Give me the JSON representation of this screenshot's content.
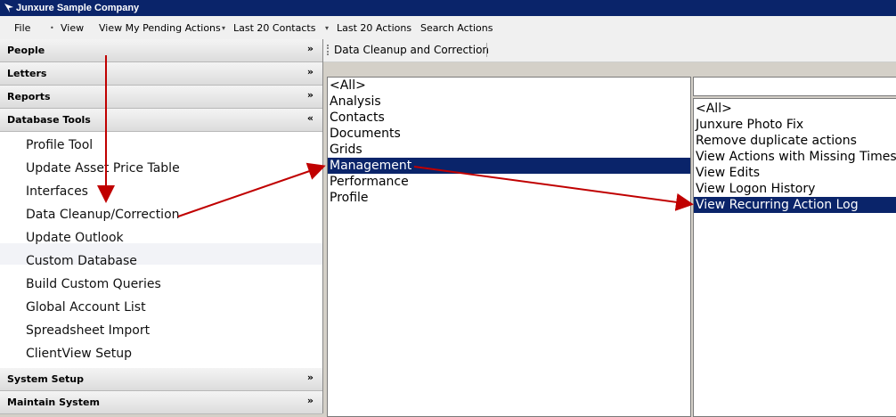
{
  "window": {
    "title": "Junxure Sample Company"
  },
  "menu": {
    "file": "File",
    "view": "View",
    "pending": "View My Pending Actions",
    "contacts": "Last 20 Contacts",
    "actions": "Last 20 Actions",
    "search": "Search Actions"
  },
  "nav": {
    "categories": {
      "people": "People",
      "letters": "Letters",
      "reports": "Reports",
      "database_tools": "Database Tools",
      "system_setup": "System Setup",
      "maintain_system": "Maintain System"
    },
    "links": [
      "Profile Tool",
      "Update Asset Price Table",
      "Interfaces",
      "Data Cleanup/Correction",
      "Update Outlook",
      "Custom Database",
      "Build Custom Queries",
      "Global Account List",
      "Spreadsheet Import",
      "ClientView Setup"
    ]
  },
  "breadcrumb": "Data Cleanup and Correction",
  "categories_list": [
    "<All>",
    "Analysis",
    "Contacts",
    "Documents",
    "Grids",
    "Management",
    "Performance",
    "Profile"
  ],
  "tools_list": [
    "<All>",
    "Junxure Photo Fix",
    "Remove duplicate actions",
    "View Actions with Missing Times",
    "View Edits",
    "View Logon History",
    "View Recurring Action Log"
  ],
  "search": {
    "value": ""
  },
  "colors": {
    "selection": "#0a246a",
    "arrow": "#c00000",
    "titlebar": "#0a246a"
  },
  "icons": {
    "app": "junxure-logo-icon",
    "collapse": "double-chevron-up-icon",
    "expand": "double-chevron-down-icon"
  }
}
